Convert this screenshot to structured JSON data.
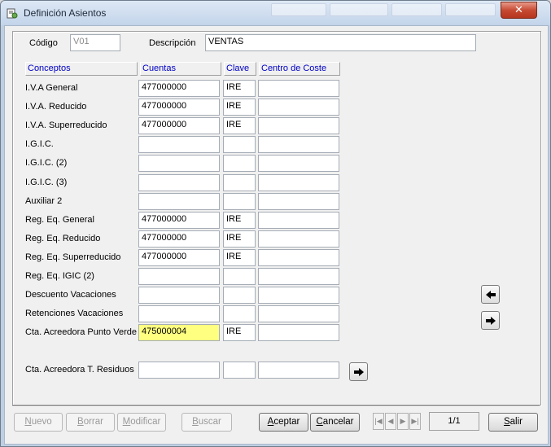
{
  "window": {
    "title": "Definición Asientos",
    "close_glyph": "✕"
  },
  "header": {
    "codigo_label": "Código",
    "codigo_value": "V01",
    "descripcion_label": "Descripción",
    "descripcion_value": "VENTAS"
  },
  "columns": [
    "Conceptos",
    "Cuentas",
    "Clave",
    "Centro de Coste"
  ],
  "rows": [
    {
      "concepto": "I.V.A General",
      "cuenta": "477000000",
      "clave": "IRE",
      "centro": ""
    },
    {
      "concepto": "I.V.A. Reducido",
      "cuenta": "477000000",
      "clave": "IRE",
      "centro": ""
    },
    {
      "concepto": "I.V.A. Superreducido",
      "cuenta": "477000000",
      "clave": "IRE",
      "centro": ""
    },
    {
      "concepto": "I.G.I.C.",
      "cuenta": "",
      "clave": "",
      "centro": ""
    },
    {
      "concepto": "I.G.I.C. (2)",
      "cuenta": "",
      "clave": "",
      "centro": ""
    },
    {
      "concepto": "I.G.I.C. (3)",
      "cuenta": "",
      "clave": "",
      "centro": ""
    },
    {
      "concepto": "Auxiliar 2",
      "cuenta": "",
      "clave": "",
      "centro": ""
    },
    {
      "concepto": "Reg. Eq. General",
      "cuenta": "477000000",
      "clave": "IRE",
      "centro": ""
    },
    {
      "concepto": "Reg. Eq. Reducido",
      "cuenta": "477000000",
      "clave": "IRE",
      "centro": ""
    },
    {
      "concepto": "Reg. Eq. Superreducido",
      "cuenta": "477000000",
      "clave": "IRE",
      "centro": ""
    },
    {
      "concepto": "Reg. Eq. IGIC (2)",
      "cuenta": "",
      "clave": "",
      "centro": ""
    },
    {
      "concepto": "Descuento Vacaciones",
      "cuenta": "",
      "clave": "",
      "centro": ""
    },
    {
      "concepto": "Retenciones Vacaciones",
      "cuenta": "",
      "clave": "",
      "centro": ""
    },
    {
      "concepto": "Cta. Acreedora Punto Verde",
      "cuenta": "475000004",
      "clave": "IRE",
      "centro": ""
    }
  ],
  "extra_row": {
    "concepto": "Cta. Acreedora T. Residuos",
    "cuenta": "",
    "clave": "",
    "centro": ""
  },
  "buttons": {
    "nuevo": {
      "first": "N",
      "rest": "uevo"
    },
    "borrar": {
      "first": "B",
      "rest": "orrar"
    },
    "modificar": {
      "first": "M",
      "rest": "odificar"
    },
    "buscar": {
      "first": "B",
      "rest": "uscar"
    },
    "aceptar": {
      "first": "A",
      "rest": "ceptar"
    },
    "cancelar": {
      "first": "C",
      "rest": "ancelar"
    },
    "salir": {
      "first": "S",
      "rest": "alir"
    }
  },
  "pager": {
    "text": "1/1"
  },
  "icons": [
    "app-icon",
    "close-icon",
    "arrow-left-icon",
    "arrow-right-icon",
    "first-record-icon",
    "prev-record-icon",
    "next-record-icon",
    "last-record-icon"
  ],
  "colors": {
    "highlight_field": "#ffff80",
    "header_text": "#0000c8",
    "close_button": "#c74a33"
  }
}
